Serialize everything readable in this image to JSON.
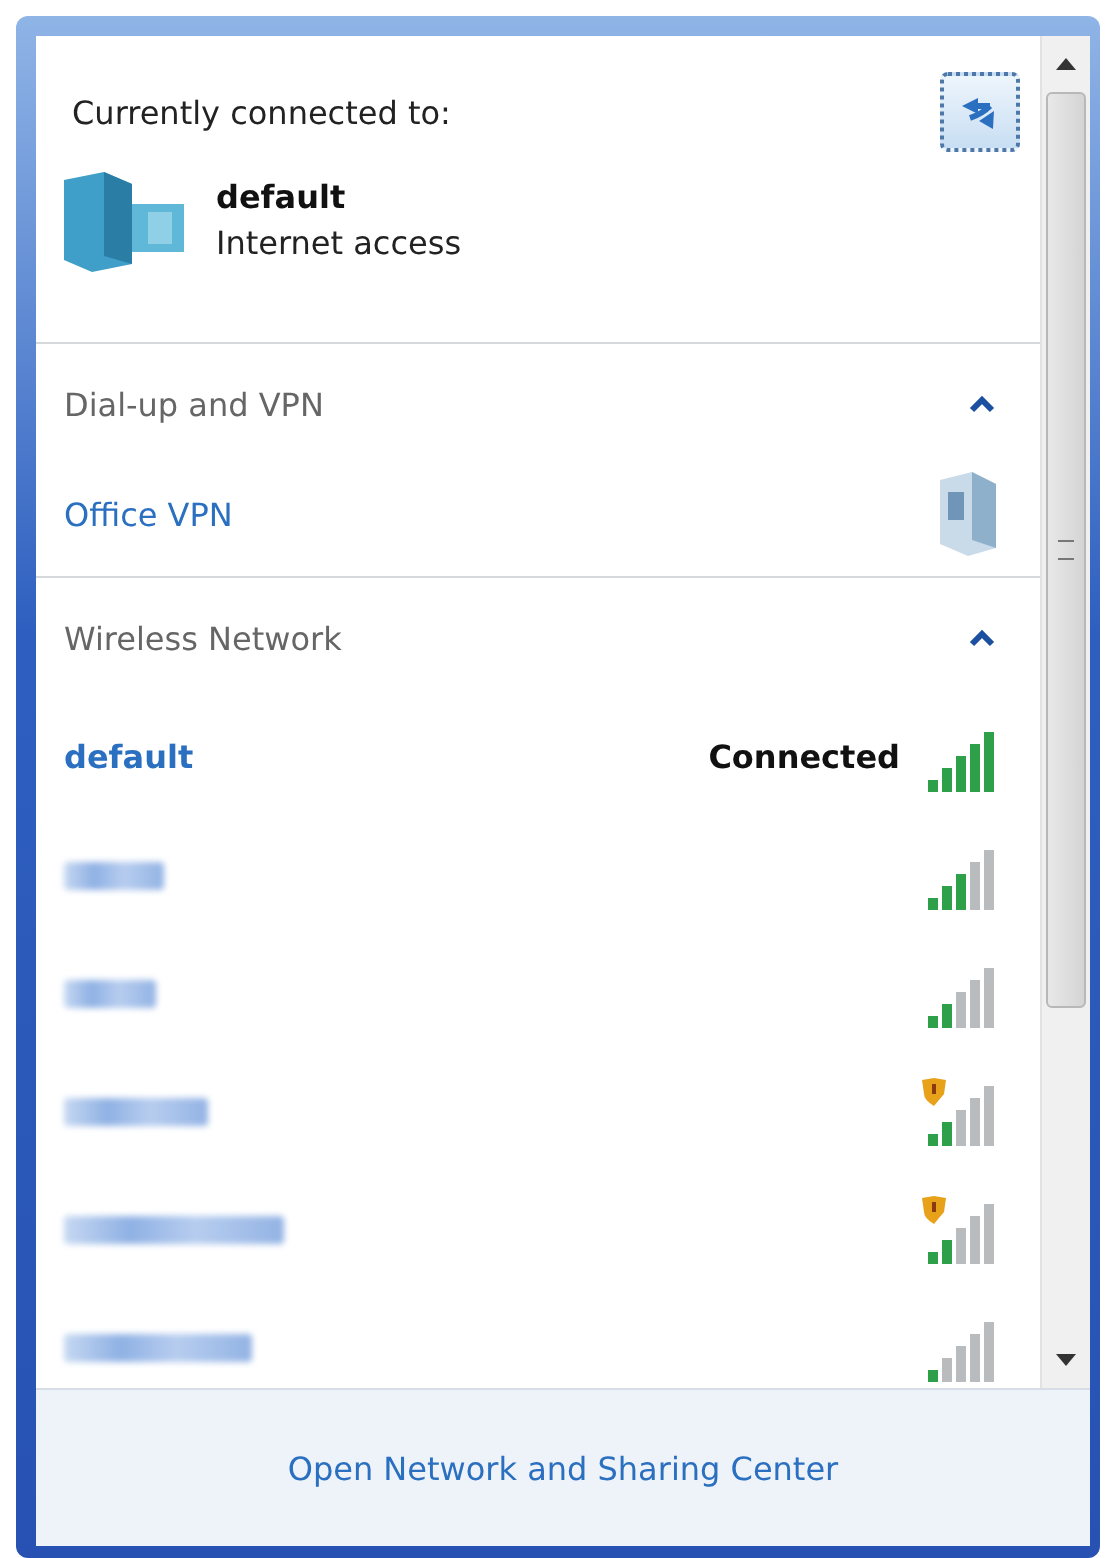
{
  "header": {
    "title": "Currently connected to:",
    "connection": {
      "name": "default",
      "status": "Internet access"
    }
  },
  "sections": [
    {
      "title": "Dial-up and VPN",
      "expanded": true,
      "items": [
        {
          "kind": "vpn",
          "name": "Office VPN"
        }
      ]
    },
    {
      "title": "Wireless Network",
      "expanded": true,
      "items": [
        {
          "kind": "wifi",
          "name": "default",
          "status": "Connected",
          "level": 1,
          "secured": false,
          "redacted": false
        },
        {
          "kind": "wifi",
          "level": 0.6,
          "secured": false,
          "redacted": true
        },
        {
          "kind": "wifi",
          "level": 0.4,
          "secured": false,
          "redacted": true
        },
        {
          "kind": "wifi",
          "level": 0.4,
          "secured": true,
          "redacted": true
        },
        {
          "kind": "wifi",
          "level": 0.4,
          "secured": true,
          "redacted": true
        },
        {
          "kind": "wifi",
          "level": 0.2,
          "secured": false,
          "redacted": true
        }
      ]
    }
  ],
  "footer": {
    "link": "Open Network and Sharing Center"
  }
}
